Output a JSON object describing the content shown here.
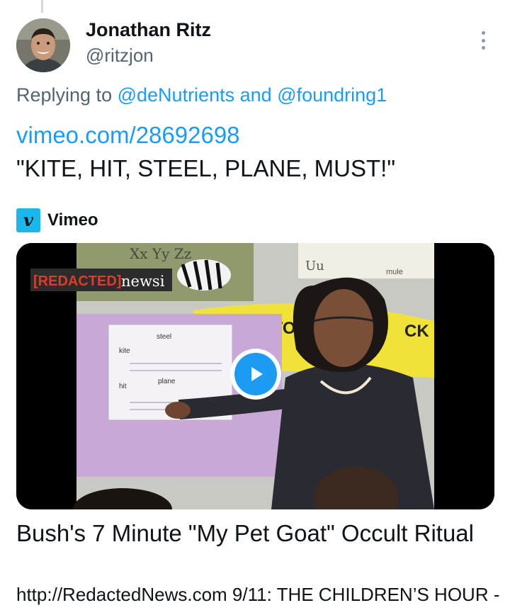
{
  "tweet": {
    "display_name": "Jonathan Ritz",
    "handle": "@ritzjon",
    "avatar_icon": "user-avatar",
    "more_icon": "more-vertical-icon",
    "reply_prefix": "Replying to",
    "reply_mention_1": "@deNutrients",
    "reply_and": "and",
    "reply_mention_2": "@foundring1",
    "link_text": "vimeo.com/28692698",
    "body_text": "\"KITE, HIT, STEEL, PLANE, MUST!\""
  },
  "card": {
    "source_icon_letter": "v",
    "source_name": "Vimeo",
    "thumbnail": {
      "overlay_logo_text_red": "[REDACTED]",
      "overlay_logo_text_white": "newsi",
      "board_letters": "Xx Yy Zz",
      "board_banner": "APPY TO",
      "board_banner_right": "CK",
      "card_top_right": "Uu",
      "card_top_right_label": "mule",
      "worksheet_words": [
        "kite",
        "hit",
        "steel",
        "plane"
      ],
      "play_icon": "play-icon"
    },
    "title": "Bush's 7 Minute \"My Pet Goat\" Occult Ritual",
    "description": "http://RedactedNews.com 9/11: THE CHILDREN’S HOUR -"
  },
  "colors": {
    "accent": "#1d9bf0",
    "secondary_text": "#536471",
    "vimeo_brand": "#1ab7ea"
  }
}
